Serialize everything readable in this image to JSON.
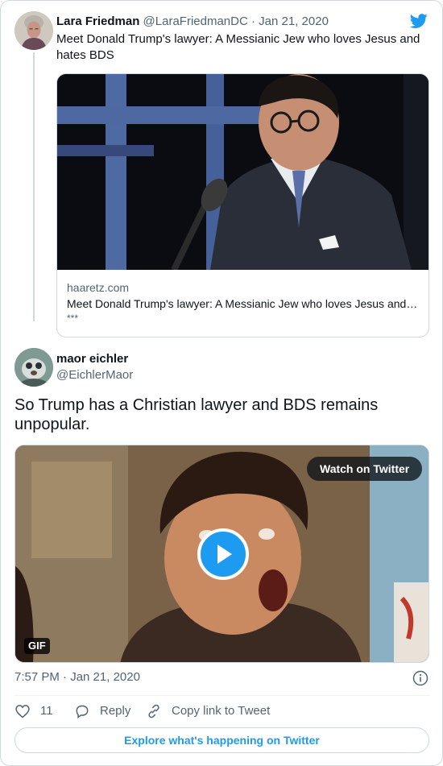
{
  "parent_tweet": {
    "author_name": "Lara Friedman",
    "author_handle": "@LaraFriedmanDC",
    "separator": "·",
    "date": "Jan 21, 2020",
    "text": "Meet Donald Trump's lawyer: A Messianic Jew who loves Jesus and hates BDS",
    "card": {
      "domain": "haaretz.com",
      "title": "Meet Donald Trump's lawyer: A Messianic Jew who loves Jesus and hates BDS",
      "description": "***"
    }
  },
  "tweet": {
    "author_name": "maor eichler",
    "author_handle": "@EichlerMaor",
    "text": "So Trump has a Christian lawyer and BDS remains unpopular.",
    "media": {
      "watch_label": "Watch on Twitter",
      "badge": "GIF"
    },
    "timestamp": "7:57 PM · Jan 21, 2020",
    "actions": {
      "like_count": "11",
      "reply_label": "Reply",
      "copy_label": "Copy link to Tweet"
    },
    "explore_label": "Explore what's happening on Twitter"
  },
  "colors": {
    "accent": "#1d9bf0",
    "text": "#0f1419",
    "muted": "#536471",
    "border": "#cfd9de"
  },
  "icons": [
    "twitter-bird-icon",
    "play-icon",
    "info-icon",
    "heart-icon",
    "reply-icon",
    "link-icon"
  ]
}
